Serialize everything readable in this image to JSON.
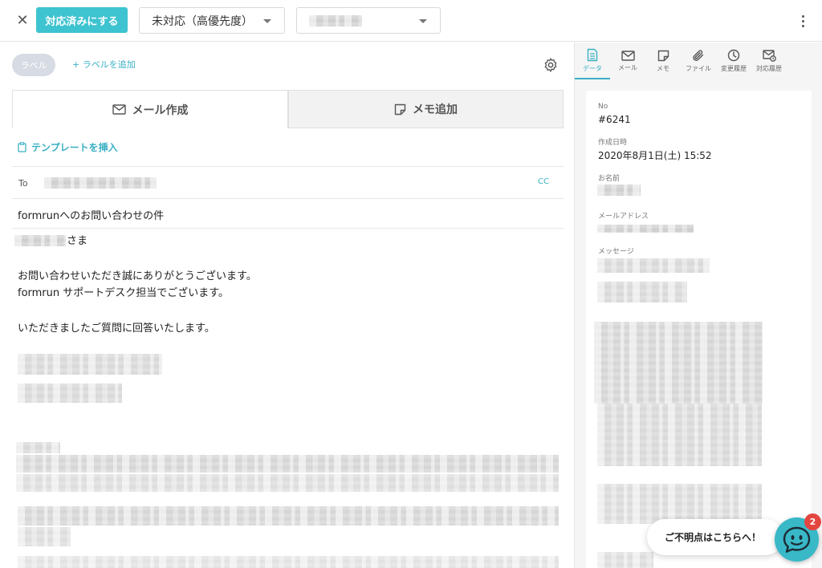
{
  "topbar": {
    "done_label": "対応済みにする",
    "status_value": "未対応（高優先度）",
    "assignee_value": ""
  },
  "labels": {
    "pill": "ラベル",
    "add": "+ ラベルを追加"
  },
  "compose_tabs": [
    {
      "label": "メール作成",
      "icon": "mail-icon"
    },
    {
      "label": "メモ追加",
      "icon": "memo-icon"
    }
  ],
  "compose": {
    "insert_template": "テンプレートを挿入",
    "to_label": "To",
    "cc_label": "CC",
    "subject": "formrunへのお問い合わせの件",
    "salutation_suffix": "さま",
    "line1": "お問い合わせいただき誠にありがとうございます。",
    "line2": "formrun サポートデスク担当でございます。",
    "line3": "いただきましたご質問に回答いたします。"
  },
  "side_tabs": [
    {
      "label": "データ",
      "icon": "document-icon",
      "active": true
    },
    {
      "label": "メール",
      "icon": "mail-icon",
      "active": false
    },
    {
      "label": "メモ",
      "icon": "memo-icon",
      "active": false
    },
    {
      "label": "ファイル",
      "icon": "paperclip-icon",
      "active": false
    },
    {
      "label": "変更履歴",
      "icon": "clock-icon",
      "active": false
    },
    {
      "label": "対応履歴",
      "icon": "mail-history-icon",
      "active": false
    }
  ],
  "details": {
    "no_label": "No",
    "no_value": "#6241",
    "created_label": "作成日時",
    "created_value": "2020年8月1日(土) 15:52",
    "name_label": "お名前",
    "email_label": "メールアドレス",
    "message_label": "メッセージ"
  },
  "help": {
    "bubble": "ご不明点はこちらへ！",
    "badge_count": "2"
  },
  "colors": {
    "accent": "#3ec3d0",
    "link": "#3ab0c4",
    "badge": "#e4453f"
  }
}
